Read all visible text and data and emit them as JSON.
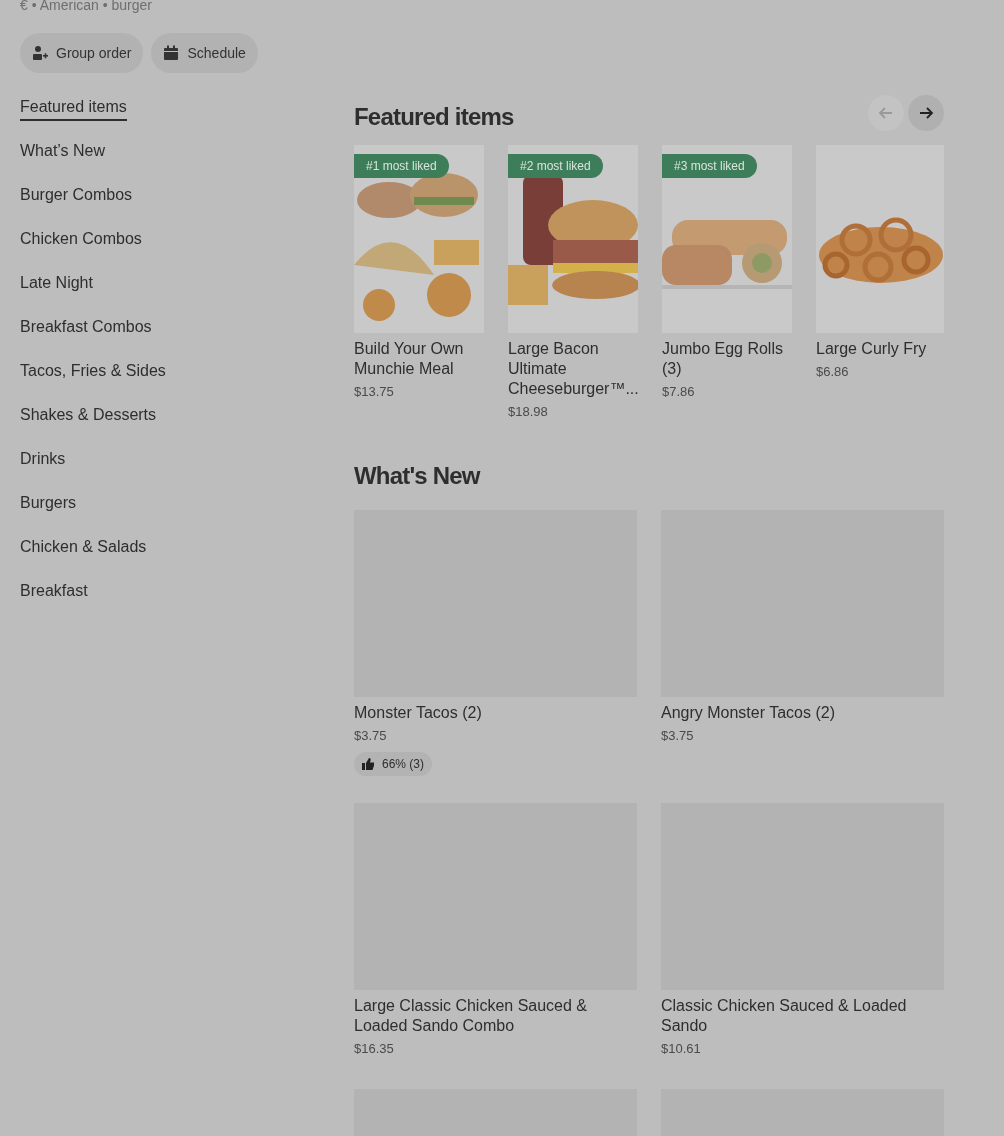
{
  "store_meta": "€ • American • burger",
  "actions": [
    {
      "kind": "group",
      "label": "Group order"
    },
    {
      "kind": "schedule",
      "label": "Schedule"
    }
  ],
  "sidebar": {
    "items": [
      {
        "label": "Featured items",
        "selected": true
      },
      {
        "label": "What’s New",
        "selected": false
      },
      {
        "label": "Burger Combos",
        "selected": false
      },
      {
        "label": "Chicken Combos",
        "selected": false
      },
      {
        "label": "Late Night",
        "selected": false
      },
      {
        "label": "Breakfast Combos",
        "selected": false
      },
      {
        "label": "Tacos, Fries & Sides",
        "selected": false
      },
      {
        "label": "Shakes & Desserts",
        "selected": false
      },
      {
        "label": "Drinks",
        "selected": false
      },
      {
        "label": "Burgers",
        "selected": false
      },
      {
        "label": "Chicken & Salads",
        "selected": false
      },
      {
        "label": "Breakfast",
        "selected": false
      }
    ]
  },
  "featured": {
    "title": "Featured items",
    "prev_disabled": true,
    "next_disabled": false,
    "items": [
      {
        "badge": "#1 most liked",
        "name": "Build Your Own Munchie Meal",
        "price": "$13.75",
        "kind": "picture"
      },
      {
        "badge": "#2 most liked",
        "name": "Large Bacon Ultimate Cheeseburger™...",
        "price": "$18.98",
        "kind": "picture"
      },
      {
        "badge": "#3 most liked",
        "name": "Jumbo Egg Rolls (3)",
        "price": "$7.86",
        "kind": "picture"
      },
      {
        "name": "Large Curly Fry",
        "price": "$6.86",
        "kind": "picture"
      }
    ]
  },
  "whats_new": {
    "title": "What's New",
    "items": [
      {
        "kind": "item",
        "name": "Monster Tacos (2)",
        "price": "$3.75",
        "rating": "66% (3)"
      },
      {
        "kind": "item",
        "name": "Angry Monster Tacos (2)",
        "price": "$3.75"
      },
      {
        "kind": "item",
        "name": "Large Classic Chicken Sauced & Loaded Sando Combo",
        "price": "$16.35"
      },
      {
        "kind": "item",
        "name": "Classic Chicken Sauced & Loaded Sando",
        "price": "$10.61"
      },
      {
        "kind": "tile"
      },
      {
        "kind": "tile"
      }
    ]
  }
}
